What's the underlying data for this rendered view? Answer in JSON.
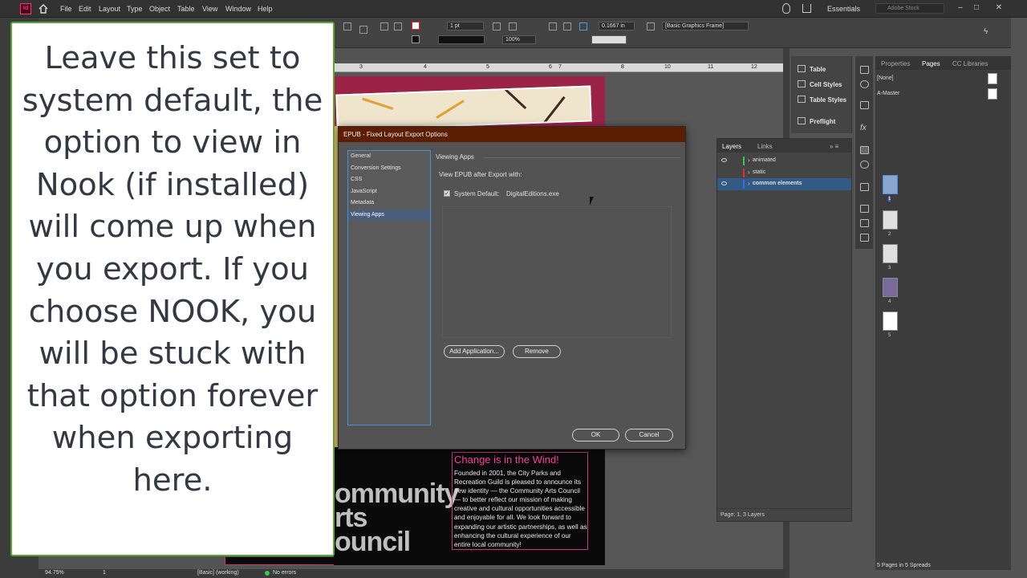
{
  "menubar": {
    "app_logo": "Id",
    "items": [
      "File",
      "Edit",
      "Layout",
      "Type",
      "Object",
      "Table",
      "View",
      "Window",
      "Help"
    ],
    "workspace": "Essentials",
    "search_placeholder": "Adobe Stock"
  },
  "controlbar": {
    "stroke_weight": "1 pt",
    "opacity": "100%",
    "offset": "0.1667 in",
    "object_style": "[Basic Graphics Frame]"
  },
  "ruler": {
    "ticks": [
      "3",
      "4",
      "5",
      "6",
      "7",
      "8",
      "9",
      "10",
      "11",
      "12"
    ]
  },
  "document": {
    "logo_lines": [
      "ommunity",
      "rts",
      "ouncil"
    ],
    "article_heading": "Change is in the Wind!",
    "article_body": "Founded in 2001, the City Parks and Recreation Guild is pleased to announce its new identity — the Community Arts Council — to better reflect our mission of making creative and cultural opportunities accessible and enjoyable for all. We look forward to expanding our artistic partnerships, as well as enhancing the cultural experience of our entire local community!"
  },
  "dialog": {
    "title": "EPUB - Fixed Layout Export Options",
    "sidebar": [
      {
        "label": "General",
        "active": false
      },
      {
        "label": "Conversion Settings",
        "active": false
      },
      {
        "label": "CSS",
        "active": false
      },
      {
        "label": "JavaScript",
        "active": false
      },
      {
        "label": "Metadata",
        "active": false
      },
      {
        "label": "Viewing Apps",
        "active": true
      }
    ],
    "section_title": "Viewing Apps",
    "view_after_label": "View EPUB after Export with:",
    "system_default_label": "System Default:",
    "system_default_checked": true,
    "system_default_value": "DigitalEditions.exe",
    "add_app_button": "Add Application...",
    "remove_button": "Remove",
    "ok_button": "OK",
    "cancel_button": "Cancel"
  },
  "mid_panel": {
    "items": [
      "Table",
      "Cell Styles",
      "Table Styles",
      "Preflight"
    ]
  },
  "layers_panel": {
    "tabs": [
      "Layers",
      "Links"
    ],
    "layers": [
      {
        "name": "animated",
        "color": "#3cc84a",
        "selected": false
      },
      {
        "name": "static",
        "color": "#e03030",
        "selected": false
      },
      {
        "name": "common elements",
        "color": "#3a6ee0",
        "selected": true
      }
    ],
    "status": "Page: 1, 3 Layers"
  },
  "pages_panel": {
    "tabs": [
      "Properties",
      "Pages",
      "CC Libraries"
    ],
    "active_tab": "Pages",
    "masters": [
      "[None]",
      "A-Master"
    ],
    "pages": [
      "1",
      "2",
      "3",
      "4",
      "5"
    ],
    "status": "5 Pages in 5 Spreads"
  },
  "statusbar": {
    "zoom": "94.75%",
    "page": "1",
    "preflight_profile": "[Basic] (working)",
    "errors": "No errors"
  },
  "caption": {
    "text": "Leave this set to system default, the option to view in Nook (if installed) will come up when you export. If you choose NOOK, you will be stuck with that option forever when exporting here."
  }
}
